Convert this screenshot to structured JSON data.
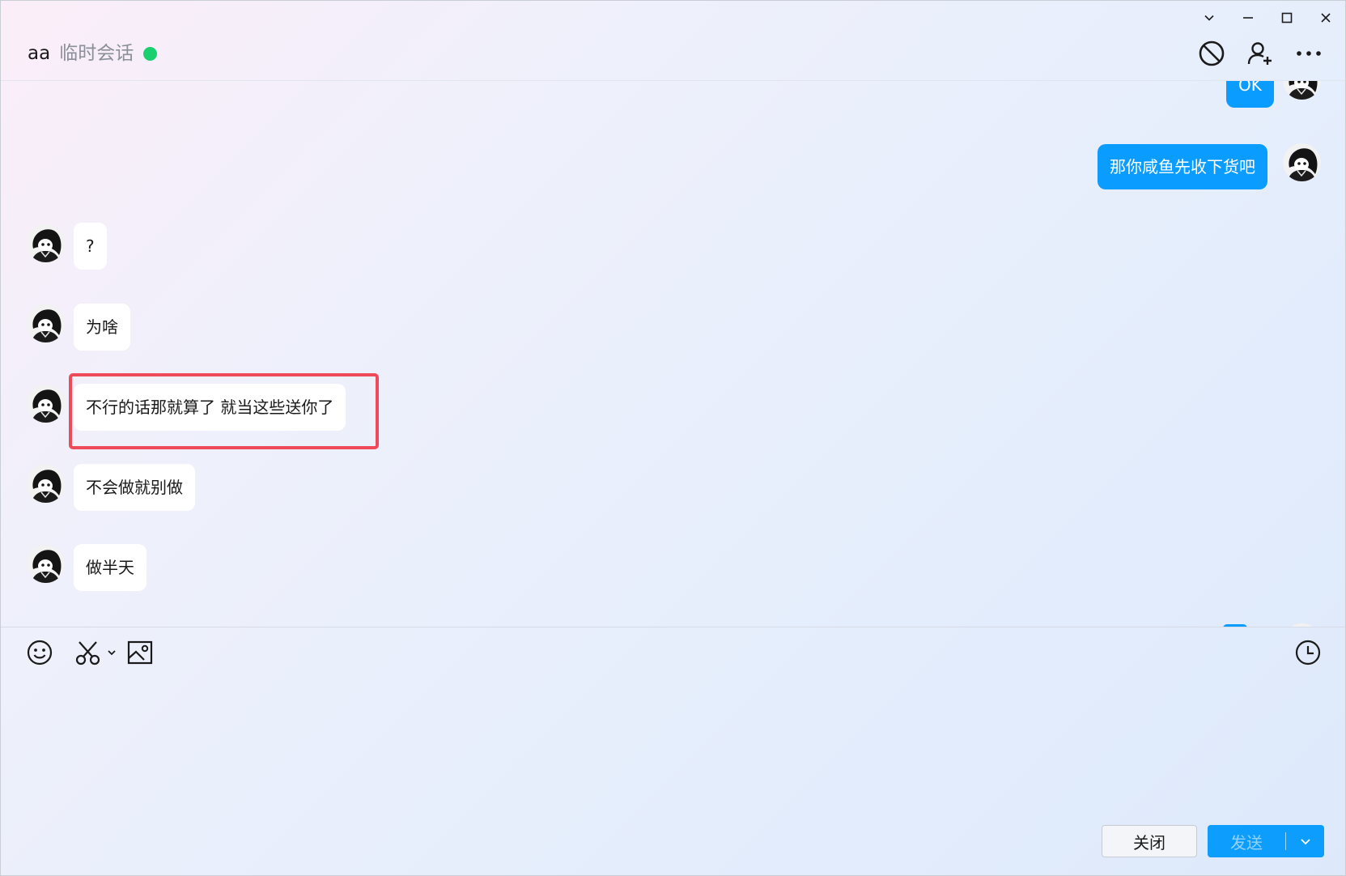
{
  "conversation": {
    "name": "aa",
    "session_type": "临时会话",
    "status_color": "#19cf6e"
  },
  "header_actions": [
    {
      "icon": "block-icon"
    },
    {
      "icon": "add-user-icon"
    },
    {
      "icon": "more-icon"
    }
  ],
  "messages": [
    {
      "direction": "out",
      "text": "OK"
    },
    {
      "direction": "out",
      "text": "那你咸鱼先收下货吧"
    },
    {
      "direction": "in",
      "text": "?"
    },
    {
      "direction": "in",
      "text": "为啥"
    },
    {
      "direction": "in",
      "text": "不行的话那就算了 就当这些送你了",
      "highlighted": true
    },
    {
      "direction": "in",
      "text": "不会做就别做"
    },
    {
      "direction": "in",
      "text": "做半天"
    }
  ],
  "toolbar": {
    "tools": [
      "emoji-icon",
      "scissors-icon",
      "chevron-down-icon",
      "image-icon",
      "clock-icon"
    ]
  },
  "buttons": {
    "close_label": "关闭",
    "send_label": "发送"
  },
  "colors": {
    "outgoing_bubble": "#0b9cff",
    "incoming_bubble": "#ffffff",
    "highlight_border": "#ee4a5a",
    "send_button": "#0d9dfd"
  }
}
